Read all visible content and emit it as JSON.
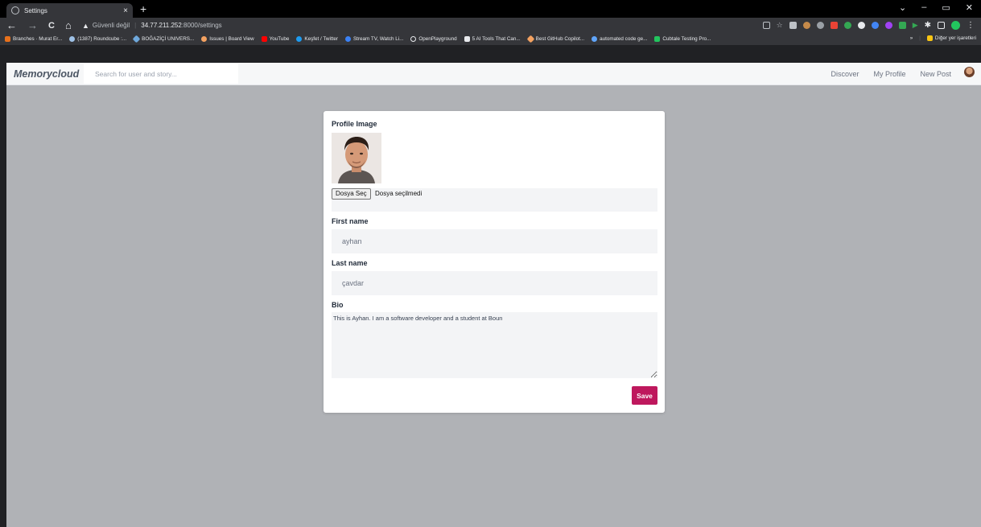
{
  "browser": {
    "tab_title": "Settings",
    "tab_close": "×",
    "new_tab": "+",
    "window_controls": [
      "⌄",
      "–",
      "▭",
      "✕"
    ],
    "nav": {
      "back": "←",
      "forward": "→",
      "reload": "C",
      "home": "⌂"
    },
    "address": {
      "security_label": "Güvenli değil",
      "host": "34.77.211.252",
      "path": ":8000/settings"
    },
    "bookmarks": [
      {
        "label": "Branches · Murat Er...",
        "color": "#e8711c"
      },
      {
        "label": "(1387) Roundcube :...",
        "color": "#9ec1e6"
      },
      {
        "label": "BOĞAZİÇİ UNIVERS...",
        "color": "#6fa8dc"
      },
      {
        "label": "Issues | Board View",
        "color": "#f4a261"
      },
      {
        "label": "YouTube",
        "color": "#ff0000"
      },
      {
        "label": "Keşfet / Twitter",
        "color": "#1d9bf0"
      },
      {
        "label": "Stream TV, Watch Li...",
        "color": "#3b82f6"
      },
      {
        "label": "OpenPlayground",
        "color": "#e8eaed"
      },
      {
        "label": "5 AI Tools That Can...",
        "color": "#e8eaed"
      },
      {
        "label": "Best GitHub Copilot...",
        "color": "#f4a261"
      },
      {
        "label": "automated code ge...",
        "color": "#60a5fa"
      },
      {
        "label": "Cubtale Testing Pro...",
        "color": "#22c55e"
      }
    ],
    "bookmarks_more": "»",
    "other_bookmarks": "Diğer yer işaretleri",
    "other_bookmarks_color": "#f9c513"
  },
  "app": {
    "brand": "Memorycloud",
    "search_placeholder": "Search for user and story...",
    "nav_links": [
      "Discover",
      "My Profile",
      "New Post"
    ]
  },
  "form": {
    "profile_image_label": "Profile Image",
    "file_button": "Dosya Seç",
    "file_status": "Dosya seçilmedi",
    "first_name_label": "First name",
    "first_name_value": "ayhan",
    "last_name_label": "Last name",
    "last_name_value": "çavdar",
    "bio_label": "Bio",
    "bio_value": "This is Ayhan. I am a software developer and a student at Boun",
    "save_label": "Save"
  },
  "colors": {
    "accent": "#be185d",
    "page_background": "#b0b2b6",
    "field_background": "#f3f4f6"
  }
}
